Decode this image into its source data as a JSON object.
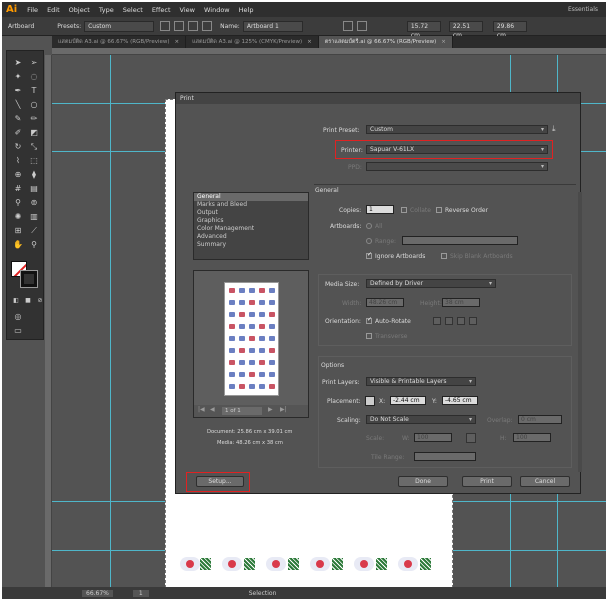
{
  "app": {
    "logo": "Ai",
    "workspace": "Essentials"
  },
  "menu": [
    "File",
    "Edit",
    "Object",
    "Type",
    "Select",
    "Effect",
    "View",
    "Window",
    "Help"
  ],
  "controlbar": {
    "artboard_label": "Artboard",
    "presets_label": "Presets:",
    "presets_value": "Custom",
    "name_label": "Name:",
    "name_value": "Artboard 1",
    "x_value": "15.72 cm",
    "y_value": "22.51 cm",
    "w_value": "29.86 cm"
  },
  "tabs": [
    {
      "label": "แสตมป์ติด A3.ai @ 66.67% (RGB/Preview)",
      "active": false
    },
    {
      "label": "แสตมป์ติด A3.ai @ 125% (CMYK/Preview)",
      "active": false
    },
    {
      "label": "ตราแสตมป์ตรี.ai @ 66.67% (RGB/Preview)",
      "active": true
    }
  ],
  "statusbar": {
    "zoom": "66.67%",
    "page": "1",
    "tool": "Selection"
  },
  "dialog": {
    "title": "Print",
    "print_preset_label": "Print Preset:",
    "print_preset_value": "Custom",
    "printer_label": "Printer:",
    "printer_value": "Sapuar V-61LX",
    "ppd_label": "PPD:",
    "categories": [
      "General",
      "Marks and Bleed",
      "Output",
      "Graphics",
      "Color Management",
      "Advanced",
      "Summary"
    ],
    "selected_category": "General",
    "section_general": "General",
    "copies_label": "Copies:",
    "copies_value": "1",
    "collate_label": "Collate",
    "reverse_order_label": "Reverse Order",
    "artboards_label": "Artboards:",
    "all_label": "All",
    "range_label": "Range:",
    "ignore_artboards_label": "Ignore Artboards",
    "skip_blank_label": "Skip Blank Artboards",
    "media_size_label": "Media Size:",
    "media_size_value": "Defined by Driver",
    "width_label": "Width:",
    "width_value": "48.26 cm",
    "height_label": "Height:",
    "height_value": "38 cm",
    "orientation_label": "Orientation:",
    "auto_rotate_label": "Auto-Rotate",
    "transverse_label": "Transverse",
    "options_label": "Options",
    "print_layers_label": "Print Layers:",
    "print_layers_value": "Visible & Printable Layers",
    "placement_label": "Placement:",
    "x_label": "X:",
    "x_value": "-2.44 cm",
    "y_label": "Y:",
    "y_value": "-4.65 cm",
    "scaling_label": "Scaling:",
    "scaling_value": "Do Not Scale",
    "overlap_label": "Overlap:",
    "overlap_value": "0 cm",
    "scale_label": "Scale:",
    "w_label": "W:",
    "w_value": "100",
    "h_label": "H:",
    "h_value": "100",
    "tile_range_label": "Tile Range:",
    "page_nav": "1 of 1",
    "document_info": "Document: 25.86 cm x 39.01 cm",
    "media_info": "Media: 48.26 cm x 38 cm",
    "setup_button": "Setup...",
    "done_button": "Done",
    "print_button": "Print",
    "cancel_button": "Cancel",
    "accent_color": "#e02222"
  }
}
